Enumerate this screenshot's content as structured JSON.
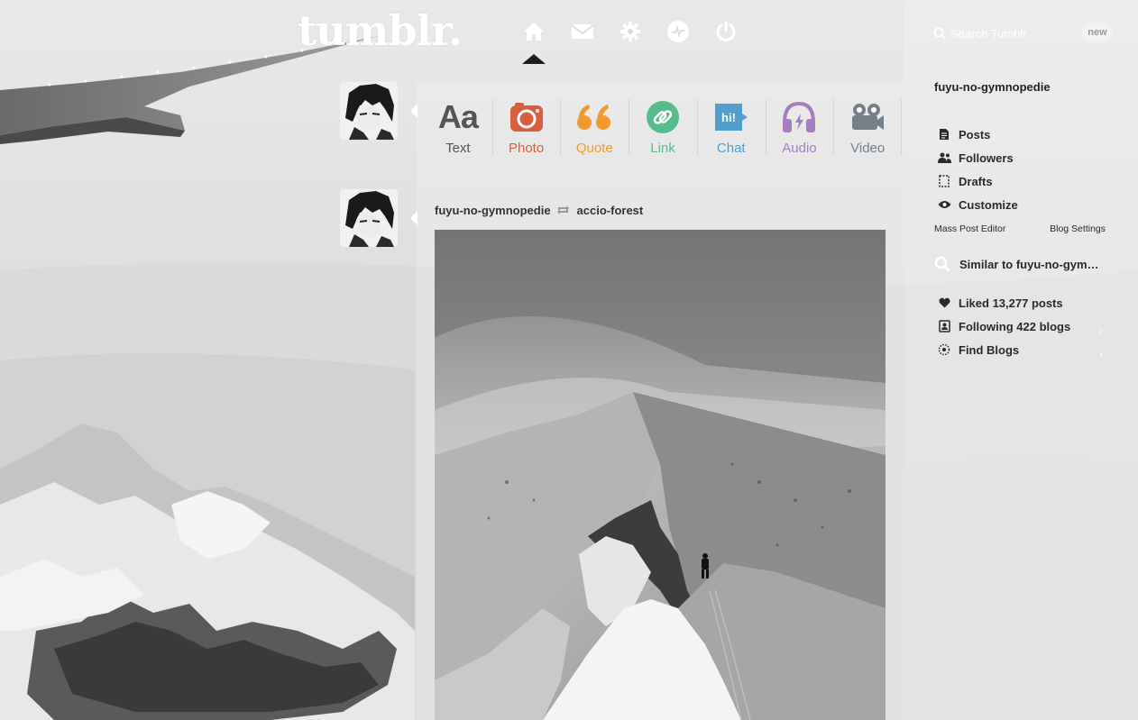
{
  "header": {
    "logo": "tumblr.",
    "nav": [
      {
        "name": "home-icon",
        "active": true
      },
      {
        "name": "inbox-icon",
        "active": false
      },
      {
        "name": "settings-icon",
        "active": false
      },
      {
        "name": "activity-icon",
        "active": false
      },
      {
        "name": "logout-icon",
        "active": false
      }
    ],
    "search_placeholder": "Search Tumblr",
    "new_badge": "new"
  },
  "post_types": [
    {
      "label": "Text",
      "icon": "text-icon",
      "color": "#555555"
    },
    {
      "label": "Photo",
      "icon": "camera-icon",
      "color": "#d95e40"
    },
    {
      "label": "Quote",
      "icon": "quote-icon",
      "color": "#f2992e"
    },
    {
      "label": "Link",
      "icon": "link-icon",
      "color": "#56bc8a"
    },
    {
      "label": "Chat",
      "icon": "chat-icon",
      "color": "#529ecc"
    },
    {
      "label": "Audio",
      "icon": "headphones-icon",
      "color": "#a77dc2"
    },
    {
      "label": "Video",
      "icon": "video-camera-icon",
      "color": "#748089"
    }
  ],
  "post": {
    "author": "fuyu-no-gymnopedie",
    "reblogged_from": "accio-forest"
  },
  "sidebar": {
    "blog_name": "fuyu-no-gymnopedie",
    "items": [
      {
        "label": "Posts",
        "icon": "posts-icon"
      },
      {
        "label": "Followers",
        "icon": "followers-icon"
      },
      {
        "label": "Drafts",
        "icon": "drafts-icon"
      },
      {
        "label": "Customize",
        "icon": "eye-icon"
      }
    ],
    "mass_post_editor": "Mass Post Editor",
    "blog_settings": "Blog Settings",
    "similar": "Similar to fuyu-no-gym…",
    "stats": [
      {
        "label": "Liked 13,277 posts",
        "icon": "heart-icon"
      },
      {
        "label": "Following 422 blogs",
        "icon": "following-icon"
      },
      {
        "label": "Find Blogs",
        "icon": "compass-icon"
      }
    ]
  }
}
